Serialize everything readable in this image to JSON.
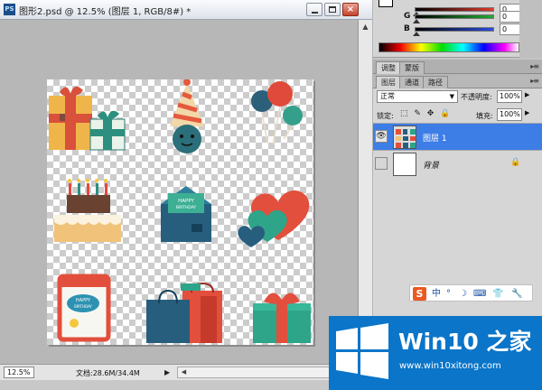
{
  "document": {
    "app_icon": "PS",
    "title": "图形2.psd @ 12.5% (图层 1, RGB/8#) *",
    "close_glyph": "×",
    "zoom": "12.5%",
    "doc_info": "文档:28.6M/34.4M",
    "canvas_icons": [
      "gift-boxes-icon",
      "party-hat-icon",
      "balloons-icon",
      "birthday-cake-icon",
      "birthday-card-icon",
      "hearts-icon",
      "tablet-birthday-icon",
      "shopping-bags-icon",
      "gift-box-icon"
    ],
    "card_texts": {
      "card_line1": "HAPPY",
      "card_line2": "BIRTHDAY",
      "bubble_line1": "HAPPY",
      "bubble_line2": "BIRTHDAY"
    }
  },
  "color_panel": {
    "sliders": [
      {
        "channel": "",
        "value": "0",
        "color": "#e03a2e"
      },
      {
        "channel": "G",
        "value": "0",
        "color": "#22aa33"
      },
      {
        "channel": "B",
        "value": "0",
        "color": "#2b4ce0"
      }
    ]
  },
  "panel_tabs_top": [
    "调整",
    "蒙版"
  ],
  "panel_tabs_layers": [
    "图层",
    "通道",
    "路径"
  ],
  "layers_panel": {
    "blend_mode": "正常",
    "opacity_label": "不透明度:",
    "opacity": "100%",
    "lock_label": "锁定:",
    "lock_icons": "⬚ ✎ ✥ 🔒",
    "fill_label": "填充:",
    "fill": "100%",
    "layers": [
      {
        "name": "图层 1",
        "selected": true,
        "visible_glyph": "👁"
      },
      {
        "name": "背景",
        "selected": false,
        "visible_glyph": ""
      }
    ]
  },
  "ime_toolbar": {
    "logo": "S",
    "items": [
      "中",
      "°",
      "☽",
      "⌨",
      "👕",
      "🔧"
    ]
  },
  "watermark": {
    "title": "Win10 之家",
    "url": "www.win10xitong.com",
    "colors": {
      "bg": "#0a75c9"
    }
  },
  "colors": {
    "selection": "#3d7de6",
    "canvas_check": "#cccccc"
  }
}
